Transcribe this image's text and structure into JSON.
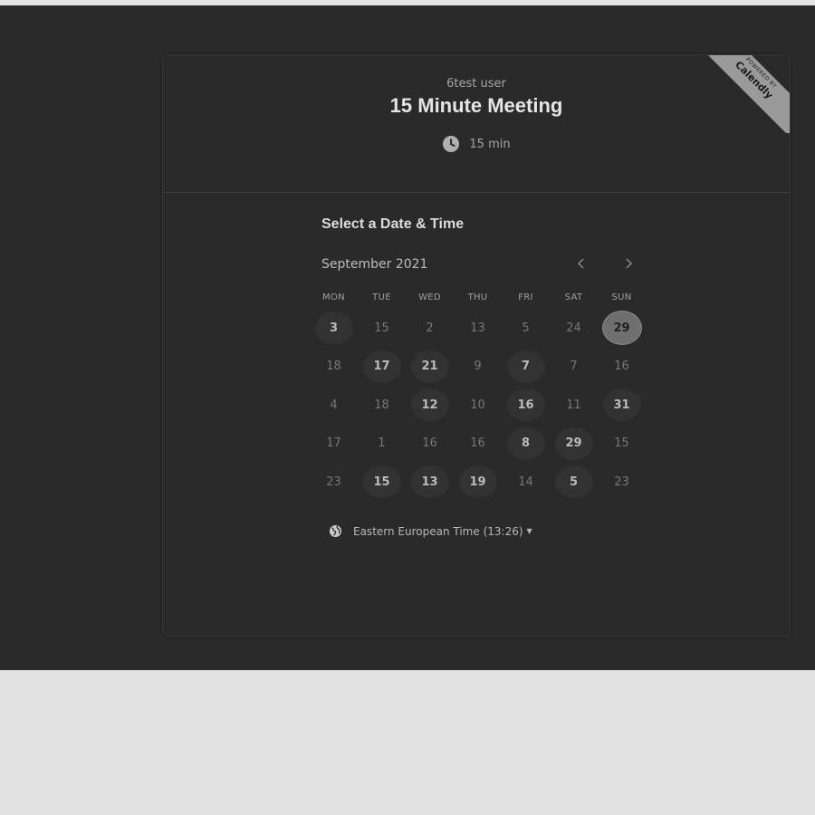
{
  "badge": {
    "small": "POWERED BY",
    "brand": "Calendly"
  },
  "header": {
    "host": "6test user",
    "title": "15 Minute Meeting",
    "duration": "15 min"
  },
  "calendar": {
    "section_title": "Select a Date & Time",
    "month": "September 2021",
    "prev_icon": "chevron-left-icon",
    "next_icon": "chevron-right-icon",
    "weekdays": [
      "MON",
      "TUE",
      "WED",
      "THU",
      "FRI",
      "SAT",
      "SUN"
    ],
    "weeks": [
      [
        {
          "d": "3",
          "s": "avail"
        },
        {
          "d": "15",
          "s": "off"
        },
        {
          "d": "2",
          "s": "off"
        },
        {
          "d": "13",
          "s": "off"
        },
        {
          "d": "5",
          "s": "off"
        },
        {
          "d": "24",
          "s": "off"
        },
        {
          "d": "29",
          "s": "selected"
        }
      ],
      [
        {
          "d": "18",
          "s": "off"
        },
        {
          "d": "17",
          "s": "avail"
        },
        {
          "d": "21",
          "s": "avail"
        },
        {
          "d": "9",
          "s": "off"
        },
        {
          "d": "7",
          "s": "avail"
        },
        {
          "d": "7",
          "s": "off"
        },
        {
          "d": "16",
          "s": "off"
        }
      ],
      [
        {
          "d": "4",
          "s": "off"
        },
        {
          "d": "18",
          "s": "off"
        },
        {
          "d": "12",
          "s": "avail"
        },
        {
          "d": "10",
          "s": "off"
        },
        {
          "d": "16",
          "s": "avail"
        },
        {
          "d": "11",
          "s": "off"
        },
        {
          "d": "31",
          "s": "avail"
        }
      ],
      [
        {
          "d": "17",
          "s": "off"
        },
        {
          "d": "1",
          "s": "off"
        },
        {
          "d": "16",
          "s": "off"
        },
        {
          "d": "16",
          "s": "off"
        },
        {
          "d": "8",
          "s": "avail"
        },
        {
          "d": "29",
          "s": "avail"
        },
        {
          "d": "15",
          "s": "off"
        }
      ],
      [
        {
          "d": "23",
          "s": "off"
        },
        {
          "d": "15",
          "s": "avail"
        },
        {
          "d": "13",
          "s": "avail"
        },
        {
          "d": "19",
          "s": "avail"
        },
        {
          "d": "14",
          "s": "off"
        },
        {
          "d": "5",
          "s": "avail"
        },
        {
          "d": "23",
          "s": "off"
        }
      ]
    ]
  },
  "timezone": {
    "label": "Eastern European Time (13:26)",
    "icon": "globe-icon"
  },
  "colors": {
    "background": "#2a2a2a",
    "page": "#e1e1e1",
    "selected": "#6f6f6f"
  }
}
